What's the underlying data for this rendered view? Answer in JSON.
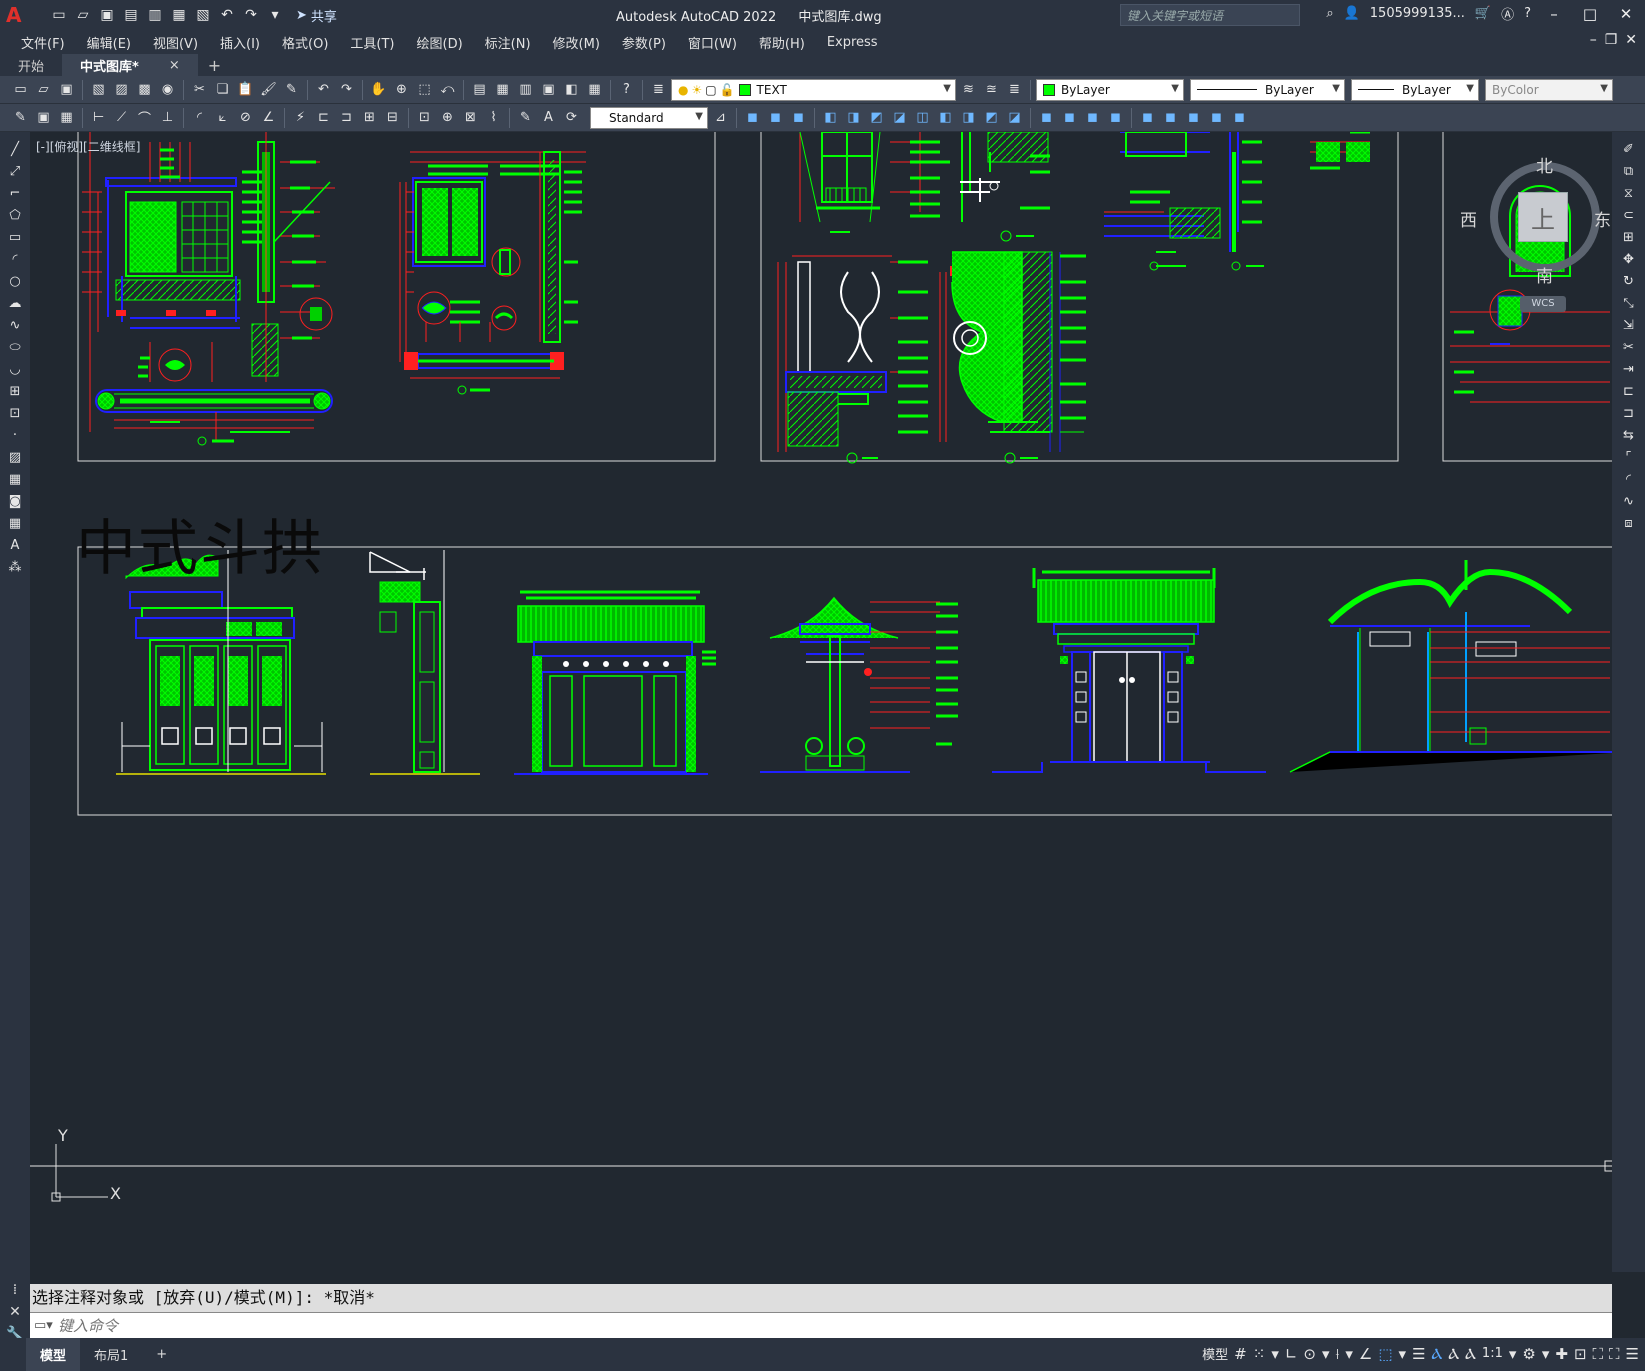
{
  "app": {
    "title": "Autodesk AutoCAD 2022",
    "filename": "中式图库.dwg",
    "logo": "A",
    "share_label": "共享",
    "search_placeholder": "键入关键字或短语",
    "user": "1505999135..."
  },
  "menu": [
    "文件(F)",
    "编辑(E)",
    "视图(V)",
    "插入(I)",
    "格式(O)",
    "工具(T)",
    "绘图(D)",
    "标注(N)",
    "修改(M)",
    "参数(P)",
    "窗口(W)",
    "帮助(H)",
    "Express"
  ],
  "tabs": {
    "start": "开始",
    "active": "中式图库*",
    "close": "×",
    "add": "+"
  },
  "toolbar": {
    "layer": "TEXT",
    "color": "ByLayer",
    "linetype": "ByLayer",
    "lineweight": "ByLayer",
    "plotstyle": "ByColor",
    "textstyle": "Standard"
  },
  "viewport": {
    "label": "[-][俯视][二维线框]",
    "section_title": "中式斗拱"
  },
  "viewcube": {
    "north": "北",
    "south": "南",
    "east": "东",
    "west": "西",
    "top": "上",
    "wcs": "WCS"
  },
  "ucs": {
    "x": "X",
    "y": "Y"
  },
  "command": {
    "history": "选择注释对象或 [放弃(U)/模式(M)]: *取消*",
    "placeholder": "键入命令"
  },
  "statusbar": {
    "model_tab": "模型",
    "layout_tab": "布局1",
    "add": "+",
    "model_label": "模型",
    "scale": "1:1"
  },
  "colors": {
    "cad_green": "#00ff00",
    "cad_red": "#ff0000",
    "cad_blue": "#2020ff",
    "background": "#212830"
  }
}
